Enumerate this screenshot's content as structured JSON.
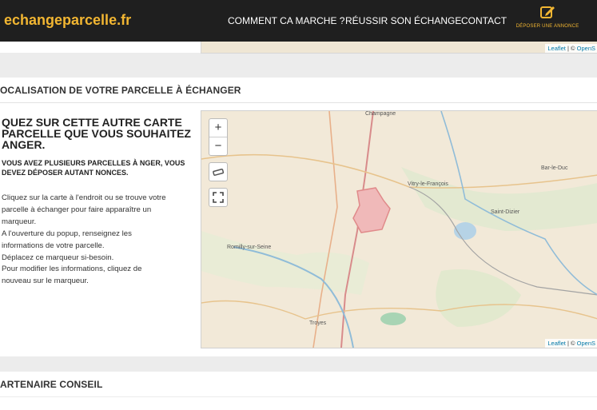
{
  "header": {
    "logo": "echangeparcelle.fr",
    "nav": [
      "COMMENT CA MARCHE ?",
      "RÉUSSIR SON ÉCHANGE",
      "CONTACT"
    ],
    "post_ad_label": "DÉPOSER UNE ANNONCE"
  },
  "map_attribution": {
    "leaflet": "Leaflet",
    "separator": " | © ",
    "osm": "OpenS"
  },
  "section": {
    "title": "OCALISATION DE VOTRE PARCELLE À ÉCHANGER",
    "heading": "QUEZ SUR CETTE AUTRE CARTE PARCELLE QUE VOUS SOUHAITEZ ANGER.",
    "subheading": "VOUS AVEZ PLUSIEURS PARCELLES À NGER, VOUS DEVEZ DÉPOSER AUTANT NONCES.",
    "steps": [
      "Cliquez sur la carte à l'endroit ou se trouve votre",
      "parcelle à échanger pour faire apparaître un",
      "marqueur.",
      "A l'ouverture du popup, renseignez les",
      "informations de votre parcelle.",
      "Déplacez ce marqueur si-besoin.",
      "Pour modifier les informations, cliquez de",
      "nouveau sur le marqueur."
    ]
  },
  "map": {
    "zoom_in": "+",
    "zoom_out": "−",
    "towns": [
      "Champagne",
      "Vitry-le-François",
      "Bar-le-Duc",
      "Saint-Dizier",
      "Romilly-sur-Seine",
      "Troyes"
    ]
  },
  "partner": {
    "title": "ARTENAIRE CONSEIL"
  }
}
